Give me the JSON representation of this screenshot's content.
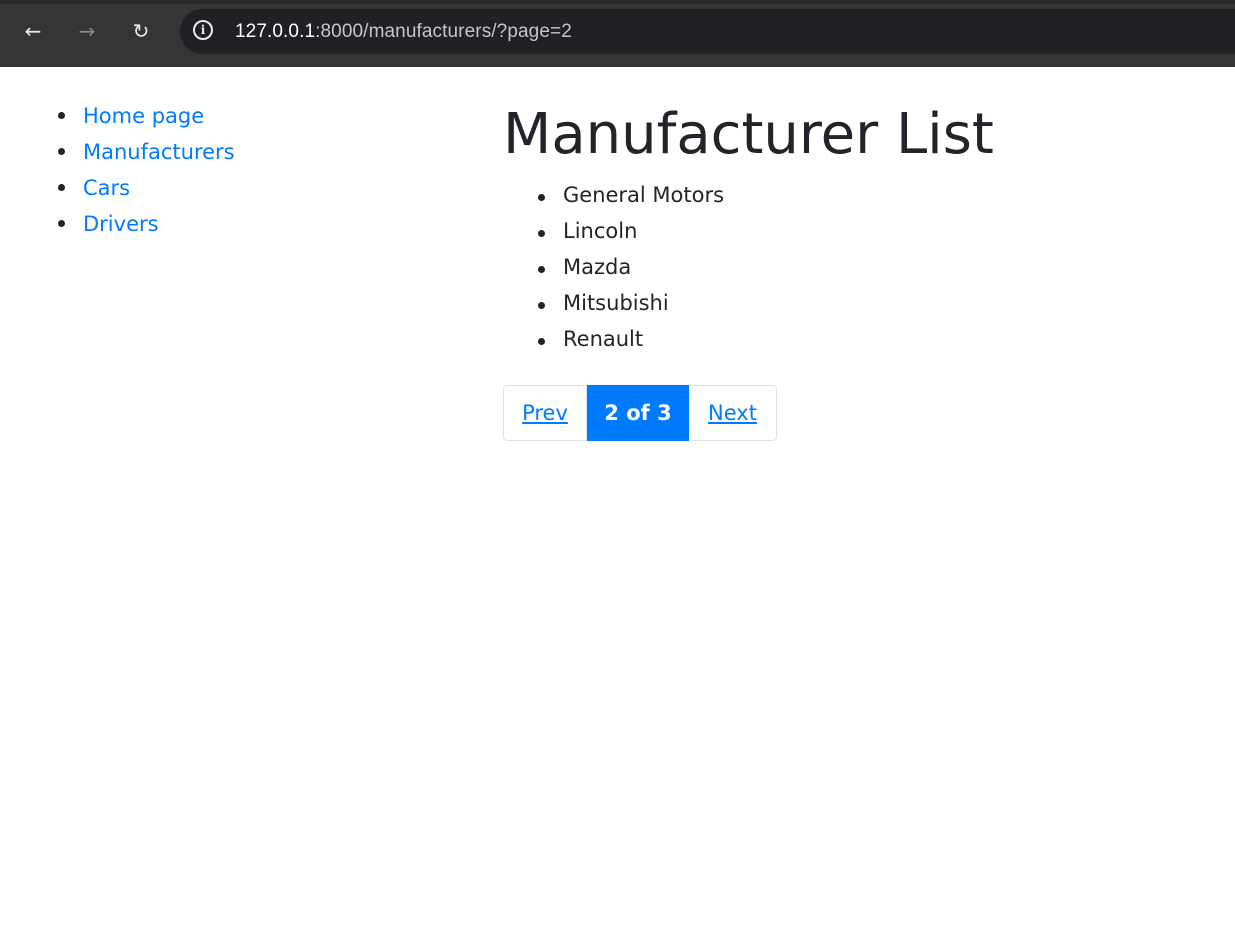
{
  "browser": {
    "back_icon": "back-arrow-icon",
    "forward_icon": "forward-arrow-icon",
    "reload_icon": "reload-icon",
    "site_info_icon": "info-icon",
    "url_host": "127.0.0.1",
    "url_path": ":8000/manufacturers/?page=2"
  },
  "sidebar": {
    "links": [
      {
        "label": "Home page"
      },
      {
        "label": "Manufacturers"
      },
      {
        "label": "Cars"
      },
      {
        "label": "Drivers"
      }
    ]
  },
  "main": {
    "title": "Manufacturer List",
    "manufacturers": [
      "General Motors",
      "Lincoln",
      "Mazda",
      "Mitsubishi",
      "Renault"
    ]
  },
  "pagination": {
    "prev_label": "Prev",
    "current_label": "2 of 3",
    "next_label": "Next"
  },
  "colors": {
    "link": "#007bff",
    "active_page_bg": "#007bff",
    "text": "#212529",
    "browser_bar": "#353535",
    "omnibox": "#202124"
  }
}
